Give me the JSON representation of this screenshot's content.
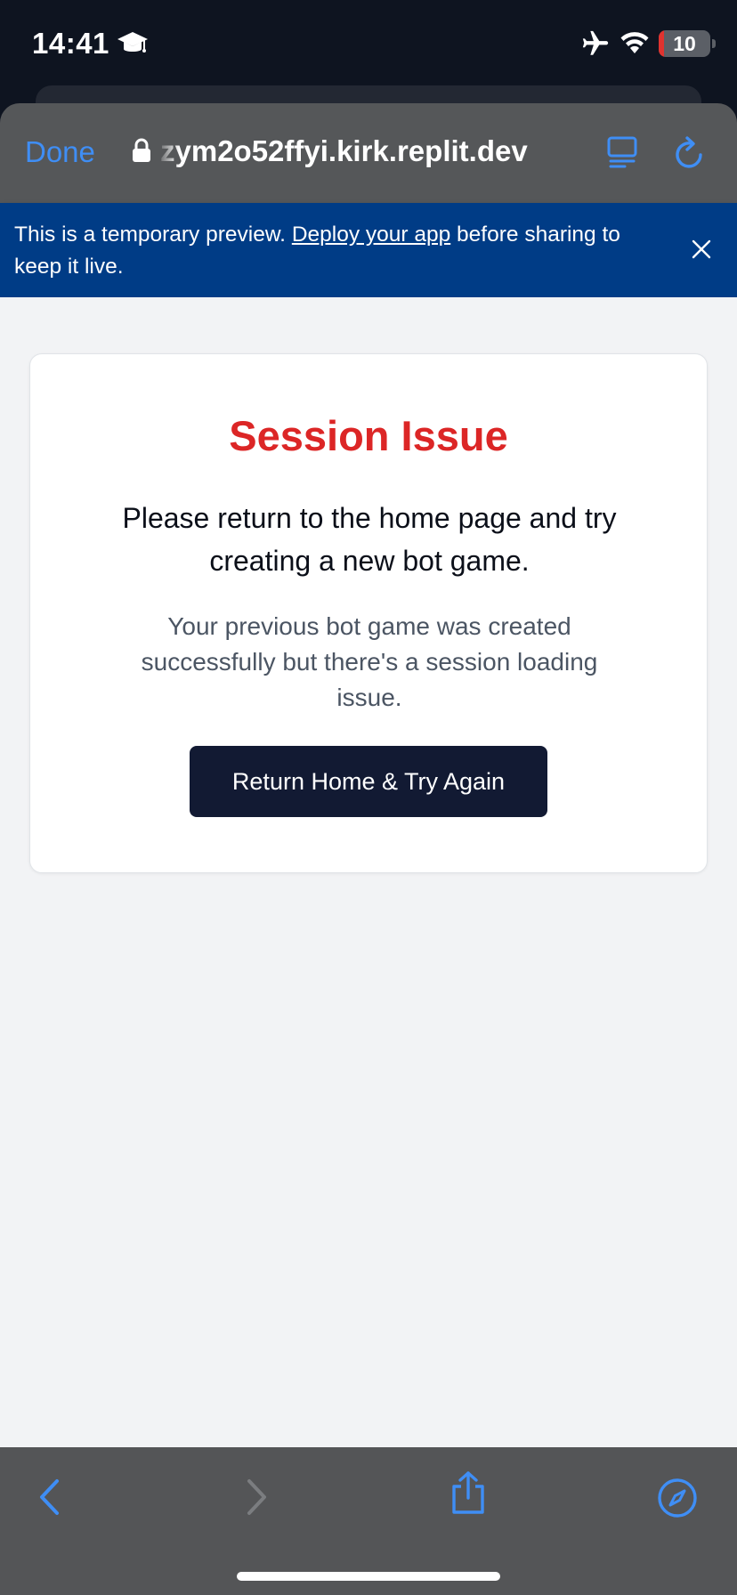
{
  "status_bar": {
    "time": "14:41",
    "battery_level": "10",
    "battery_fraction": 0.1,
    "icons": [
      "graduation-cap-icon",
      "airplane-icon",
      "wifi-icon",
      "battery-icon"
    ]
  },
  "browser": {
    "done_label": "Done",
    "url": "zym2o52ffyi.kirk.replit.dev",
    "icons": [
      "lock-icon",
      "reader-mode-icon",
      "reload-icon"
    ]
  },
  "banner": {
    "text_before": "This is a temporary preview. ",
    "link": "Deploy your app",
    "text_after": " before sharing to keep it live.",
    "close_icon": "close-icon"
  },
  "card": {
    "title": "Session Issue",
    "message": "Please return to the home page and try creating a new bot game.",
    "detail": "Your previous bot game was created successfully but there's a session loading issue.",
    "button_label": "Return Home & Try Again"
  },
  "toolbar": {
    "icons": [
      "back-icon",
      "forward-icon",
      "share-icon",
      "compass-icon"
    ]
  },
  "colors": {
    "accent": "#3f8ef5",
    "banner_bg": "#003c86",
    "title_red": "#dc2626",
    "button_bg": "#121a33",
    "page_bg": "#f2f3f5"
  }
}
